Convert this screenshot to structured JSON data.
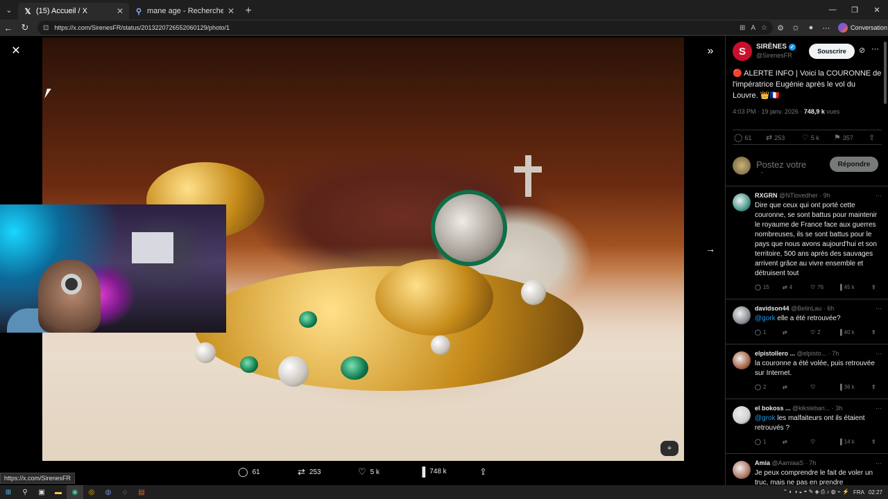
{
  "browser": {
    "tabs": [
      {
        "favicon": "𝕏",
        "title": "(15) Accueil / X",
        "active": true
      },
      {
        "favicon": "🔍",
        "title": "mane age - Recherche",
        "active": false
      }
    ],
    "url": "https://x.com/SirenesFR/status/2013220726552060129/photo/1",
    "conversation_label": "Conversation",
    "status_url": "https://x.com/SirenesFR"
  },
  "viewer": {
    "actions": {
      "replies": "61",
      "reposts": "253",
      "likes": "5 k",
      "views": "748 k"
    }
  },
  "tweet": {
    "author_name": "SIRÈNES",
    "author_handle": "@SirenesFR",
    "subscribe_label": "Souscrire",
    "text": "🔴 ALERTE INFO | Voici la COURONNE de l'impératrice Eugénie après le vol du Louvre. 👑🇫🇷",
    "time": "4:03 PM · 19 janv. 2026 · ",
    "views_count": "748,9 k",
    "views_label": " vues",
    "stats": {
      "replies": "61",
      "reposts": "253",
      "likes": "5 k",
      "bookmarks": "357"
    },
    "reply_placeholder": "Postez votre réponse",
    "reply_button": "Répondre"
  },
  "replies": [
    {
      "name": "RXGRN",
      "handle": "@NTlovedher · 9h",
      "text": "Dire que ceux qui ont porté cette couronne, se sont battus pour maintenir le royaume de France face aux guerres nombreuses, ils se sont battus pour le pays que nous avons aujourd'hui et son territoire, 500 ans après des sauvages arrivent grâce au vivre ensemble et détruisent tout",
      "mention": "",
      "replies": "15",
      "reposts": "4",
      "likes": "76",
      "views": "45 k",
      "color": "#4a9c8f"
    },
    {
      "name": "davidson44",
      "handle": "@BelinLau · 6h",
      "mention": "@gork",
      "text": " elle a été retrouvée?",
      "replies": "1",
      "reposts": "",
      "likes": "2",
      "views": "40 k",
      "color": "#8a8f95"
    },
    {
      "name": "elpistollero ...",
      "handle": "@elpisto... · 7h",
      "mention": "",
      "text": "la couronne a été volée, puis retrouvée sur Internet.",
      "replies": "2",
      "reposts": "",
      "likes": "",
      "views": "36 k",
      "color": "#a8674a"
    },
    {
      "name": "el bokoss ...",
      "handle": "@kiksleban... · 3h",
      "mention": "@grok",
      "text": " les malfaiteurs ont ils étaient retrouvés ?",
      "replies": "1",
      "reposts": "",
      "likes": "",
      "views": "14 k",
      "color": "#cfcfcf"
    },
    {
      "name": "Amia",
      "handle": "@AamiaaS · 7h",
      "mention": "",
      "text": "Je peux comprendre le fait de voler un truc, mais ne pas en prendre",
      "replies": "",
      "reposts": "",
      "likes": "",
      "views": "",
      "color": "#b07a66"
    }
  ],
  "taskbar": {
    "lang": "FRA",
    "time": "02:27"
  },
  "icons": [
    "close-icon",
    "expand-icon",
    "next-arrow-icon",
    "reply-icon",
    "repost-icon",
    "like-icon",
    "views-icon",
    "share-icon",
    "bookmark-icon",
    "more-icon",
    "verified-icon",
    "grok-icon"
  ]
}
